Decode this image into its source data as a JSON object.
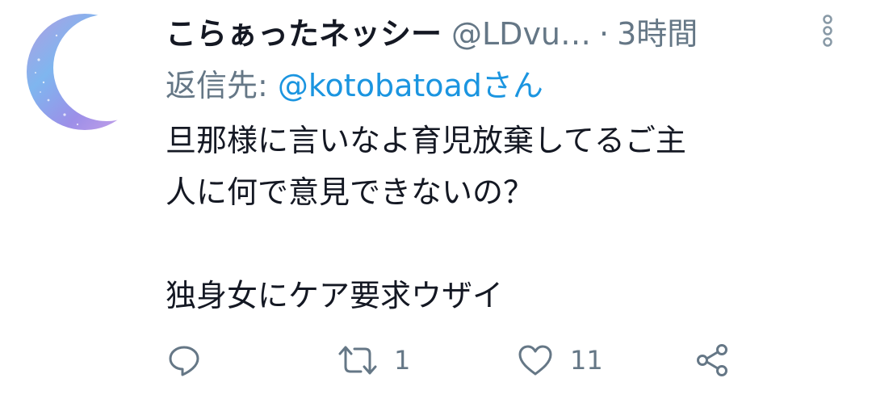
{
  "header": {
    "display_name": "こらぁったネッシー",
    "handle": "@LDvu…",
    "separator": "·",
    "time": "3時間"
  },
  "reply": {
    "prefix": "返信先:",
    "target": "@kotobatoadさん"
  },
  "tweet": {
    "lines": [
      "旦那様に言いなよ育児放棄してるご主",
      "人に何で意見できないの？",
      "",
      "独身女にケア要求ウザイ"
    ]
  },
  "actions": {
    "reply_icon": "reply-icon",
    "retweet_icon": "retweet-icon",
    "retweet_count": "1",
    "like_icon": "heart-icon",
    "like_count": "11",
    "share_icon": "share-icon"
  },
  "colors": {
    "text": "#141823",
    "secondary": "#657786",
    "link": "#1b95e0"
  }
}
